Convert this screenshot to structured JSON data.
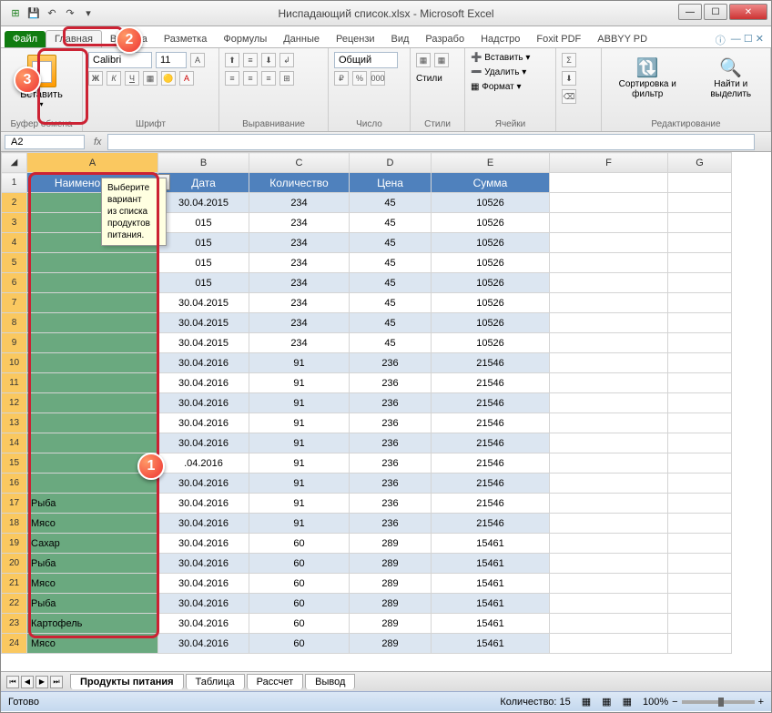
{
  "title": "Ниспадающий список.xlsx - Microsoft Excel",
  "tabs": {
    "file": "Файл",
    "main": "Главная",
    "insert": "Вставка",
    "layout": "Разметка",
    "formulas": "Формулы",
    "data": "Данные",
    "review": "Рецензи",
    "view": "Вид",
    "dev": "Разрабо",
    "addins": "Надстро",
    "foxit": "Foxit PDF",
    "abbyy": "ABBYY PD"
  },
  "ribbon": {
    "paste": "Вставить",
    "clipboard": "Буфер обмена",
    "font_name": "Calibri",
    "font_size": "11",
    "font": "Шрифт",
    "alignment": "Выравнивание",
    "number_fmt": "Общий",
    "number": "Число",
    "styles": "Стили",
    "insert_btn": "Вставить",
    "delete_btn": "Удалить",
    "format_btn": "Формат",
    "cells": "Ячейки",
    "sort": "Сортировка и фильтр",
    "find": "Найти и выделить",
    "editing": "Редактирование"
  },
  "namebox": "A2",
  "fx": "fx",
  "headers": [
    "Наименование",
    "Дата",
    "Количество",
    "Цена",
    "Сумма"
  ],
  "cols": [
    "A",
    "B",
    "C",
    "D",
    "E",
    "F",
    "G"
  ],
  "tooltip": {
    "t1": "Выберите вариант",
    "t2": "из списка",
    "t3": "продуктов",
    "t4": "питания."
  },
  "rows": [
    {
      "n": 2,
      "a": "",
      "b": "30.04.2015",
      "c": "234",
      "d": "45",
      "e": "10526"
    },
    {
      "n": 3,
      "a": "",
      "b": "015",
      "c": "234",
      "d": "45",
      "e": "10526"
    },
    {
      "n": 4,
      "a": "",
      "b": "015",
      "c": "234",
      "d": "45",
      "e": "10526"
    },
    {
      "n": 5,
      "a": "",
      "b": "015",
      "c": "234",
      "d": "45",
      "e": "10526"
    },
    {
      "n": 6,
      "a": "",
      "b": "015",
      "c": "234",
      "d": "45",
      "e": "10526"
    },
    {
      "n": 7,
      "a": "",
      "b": "30.04.2015",
      "c": "234",
      "d": "45",
      "e": "10526"
    },
    {
      "n": 8,
      "a": "",
      "b": "30.04.2015",
      "c": "234",
      "d": "45",
      "e": "10526"
    },
    {
      "n": 9,
      "a": "",
      "b": "30.04.2015",
      "c": "234",
      "d": "45",
      "e": "10526"
    },
    {
      "n": 10,
      "a": "",
      "b": "30.04.2016",
      "c": "91",
      "d": "236",
      "e": "21546"
    },
    {
      "n": 11,
      "a": "",
      "b": "30.04.2016",
      "c": "91",
      "d": "236",
      "e": "21546"
    },
    {
      "n": 12,
      "a": "",
      "b": "30.04.2016",
      "c": "91",
      "d": "236",
      "e": "21546"
    },
    {
      "n": 13,
      "a": "",
      "b": "30.04.2016",
      "c": "91",
      "d": "236",
      "e": "21546"
    },
    {
      "n": 14,
      "a": "",
      "b": "30.04.2016",
      "c": "91",
      "d": "236",
      "e": "21546"
    },
    {
      "n": 15,
      "a": "",
      "b": ".04.2016",
      "c": "91",
      "d": "236",
      "e": "21546"
    },
    {
      "n": 16,
      "a": "",
      "b": "30.04.2016",
      "c": "91",
      "d": "236",
      "e": "21546"
    },
    {
      "n": 17,
      "a": "Рыба",
      "b": "30.04.2016",
      "c": "91",
      "d": "236",
      "e": "21546"
    },
    {
      "n": 18,
      "a": "Мясо",
      "b": "30.04.2016",
      "c": "91",
      "d": "236",
      "e": "21546"
    },
    {
      "n": 19,
      "a": "Сахар",
      "b": "30.04.2016",
      "c": "60",
      "d": "289",
      "e": "15461"
    },
    {
      "n": 20,
      "a": "Рыба",
      "b": "30.04.2016",
      "c": "60",
      "d": "289",
      "e": "15461"
    },
    {
      "n": 21,
      "a": "Мясо",
      "b": "30.04.2016",
      "c": "60",
      "d": "289",
      "e": "15461"
    },
    {
      "n": 22,
      "a": "Рыба",
      "b": "30.04.2016",
      "c": "60",
      "d": "289",
      "e": "15461"
    },
    {
      "n": 23,
      "a": "Картофель",
      "b": "30.04.2016",
      "c": "60",
      "d": "289",
      "e": "15461"
    },
    {
      "n": 24,
      "a": "Мясо",
      "b": "30.04.2016",
      "c": "60",
      "d": "289",
      "e": "15461"
    }
  ],
  "sheets": {
    "s1": "Продукты питания",
    "s2": "Таблица",
    "s3": "Рассчет",
    "s4": "Вывод"
  },
  "status": {
    "ready": "Готово",
    "count_lbl": "Количество: 15",
    "zoom": "100%"
  },
  "callouts": {
    "c1": "1",
    "c2": "2",
    "c3": "3"
  }
}
